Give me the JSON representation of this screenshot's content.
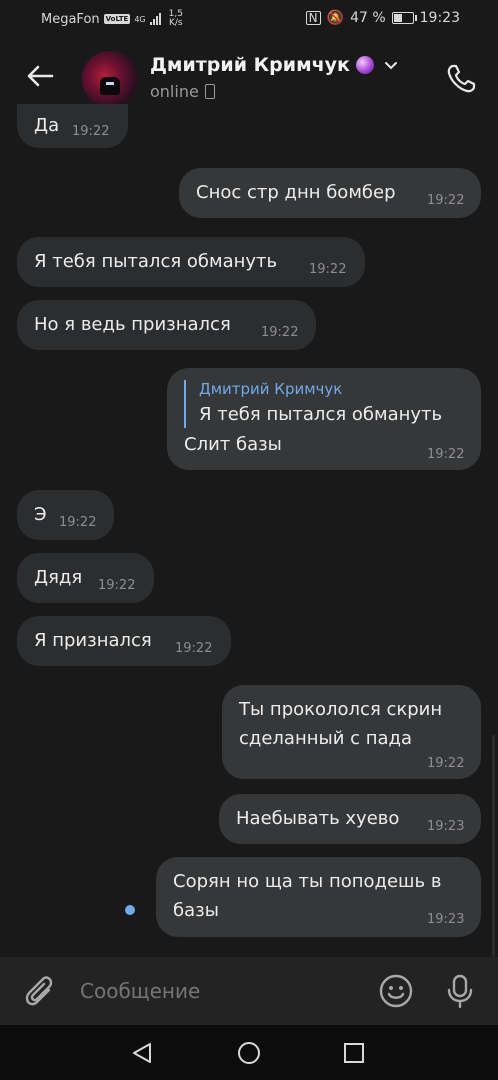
{
  "status_bar": {
    "carrier": "MegaFon",
    "volte": "VoLTE",
    "network": "4G",
    "speed": "1,5",
    "speed_unit": "K/s",
    "battery": "47 %",
    "time": "19:23"
  },
  "header": {
    "name": "Дмитрий Кримчук",
    "status": "online",
    "icons": [
      "back-arrow-icon",
      "crystal-ball-icon",
      "chevron-down-icon",
      "mobile-device-icon",
      "phone-icon"
    ]
  },
  "messages": [
    {
      "direction": "in",
      "text": "Да",
      "time": "19:22"
    },
    {
      "direction": "out",
      "text": "Снос стр днн бомбер",
      "time": "19:22"
    },
    {
      "direction": "in",
      "text": "Я тебя пытался обмануть",
      "time": "19:22"
    },
    {
      "direction": "in",
      "text": "Но я ведь признался",
      "time": "19:22"
    },
    {
      "direction": "out",
      "reply": {
        "author": "Дмитрий Кримчук",
        "text": "Я тебя пытался обмануть"
      },
      "text": "Слит базы",
      "time": "19:22"
    },
    {
      "direction": "in",
      "text": "Э",
      "time": "19:22"
    },
    {
      "direction": "in",
      "text": "Дядя",
      "time": "19:22"
    },
    {
      "direction": "in",
      "text": "Я признался",
      "time": "19:22"
    },
    {
      "direction": "out",
      "lines": [
        "Ты прокололся скрин",
        "сделанный с пада"
      ],
      "time": "19:22"
    },
    {
      "direction": "out",
      "text": "Наебывать хуево",
      "time": "19:23"
    },
    {
      "direction": "out",
      "lines": [
        "Сорян но ща ты поподешь в",
        "базы"
      ],
      "time": "19:23",
      "unread": true
    }
  ],
  "composer": {
    "placeholder": "Сообщение",
    "icons": [
      "paperclip-icon",
      "smile-icon",
      "microphone-icon"
    ]
  },
  "nav_bar": {
    "icons": [
      "nav-back-icon",
      "nav-home-icon",
      "nav-recents-icon"
    ]
  },
  "colors": {
    "background": "#19191a",
    "bubble_in": "#2c2d2e",
    "bubble_out": "#363738",
    "accent": "#71aaeb"
  }
}
